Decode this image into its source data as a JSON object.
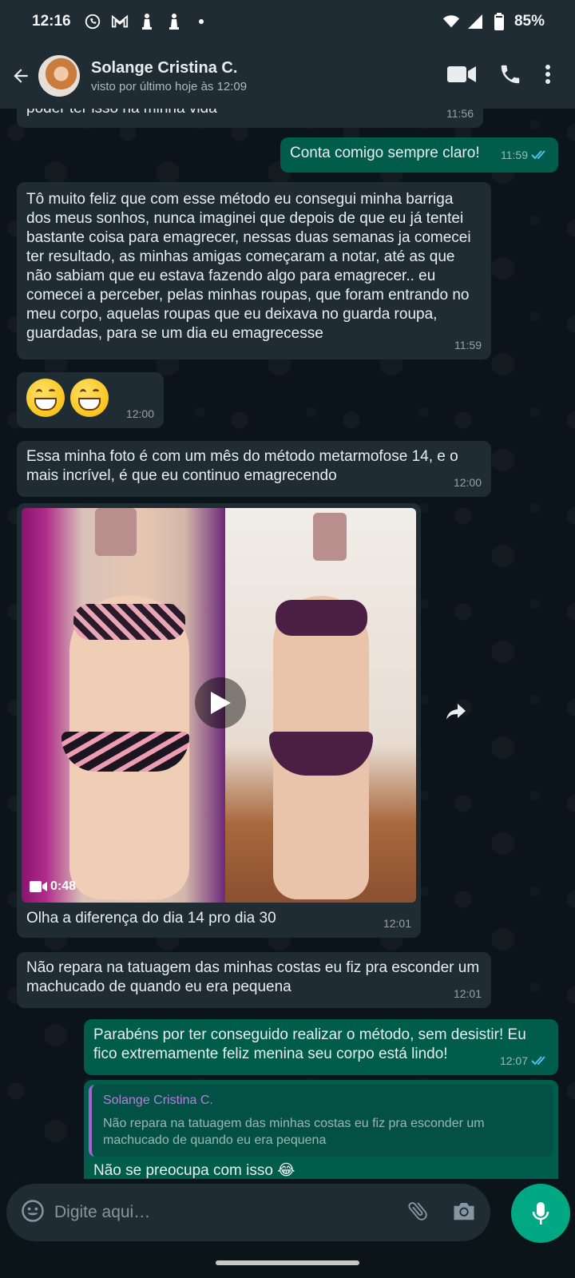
{
  "status_bar": {
    "time": "12:16",
    "battery": "85%",
    "icons": [
      "whatsapp-icon",
      "gmail-icon",
      "chess-icon",
      "chess-icon",
      "dot-icon",
      "wifi-icon",
      "signal-icon",
      "battery-icon"
    ]
  },
  "header": {
    "contact_name": "Solange Cristina C.",
    "last_seen": "visto por último hoje às 12:09",
    "icons": [
      "back-arrow-icon",
      "video-call-icon",
      "phone-icon",
      "more-vert-icon"
    ]
  },
  "messages": [
    {
      "id": "m0",
      "direction": "in",
      "text": "poder ter isso na minha vida",
      "time": "11:56"
    },
    {
      "id": "m1",
      "direction": "out",
      "text": "Conta comigo sempre claro!",
      "time": "11:59",
      "read": true
    },
    {
      "id": "m2",
      "direction": "in",
      "text": "Tô muito feliz que com esse método eu consegui minha barriga dos meus sonhos, nunca imaginei que depois de que eu já tentei bastante coisa para emagrecer, nessas duas semanas ja comecei ter resultado, as minhas amigas começaram a notar, até as que não sabiam que eu estava fazendo algo para emagrecer.. eu comecei a perceber, pelas minhas roupas, que foram entrando no meu corpo, aquelas roupas que eu deixava no guarda roupa, guardadas, para se um dia eu emagrecesse",
      "time": "11:59"
    },
    {
      "id": "m3",
      "direction": "in",
      "text": "😁😁",
      "time": "12:00"
    },
    {
      "id": "m4",
      "direction": "in",
      "text": "Essa minha foto é com um mês do método metarmofose 14, e o mais incrível, é que eu continuo emagrecendo",
      "time": "12:00"
    },
    {
      "id": "m5",
      "direction": "in",
      "type": "video",
      "duration": "0:48",
      "caption": "Olha a diferença do dia 14 pro dia 30",
      "time": "12:01"
    },
    {
      "id": "m6",
      "direction": "in",
      "text": "Não repara na tatuagem das minhas costas eu fiz pra esconder um machucado de quando eu era pequena",
      "time": "12:01"
    },
    {
      "id": "m7",
      "direction": "out",
      "text": "Parabéns por ter conseguido realizar o método, sem desistir! Eu fico extremamente feliz menina seu corpo está lindo!",
      "time": "12:07",
      "read": true
    },
    {
      "id": "m8",
      "direction": "out",
      "quote_author": "Solange Cristina C.",
      "quote_text": "Não repara na tatuagem das minhas costas eu fiz pra esconder um machucado de quando eu era pequena",
      "text": "Não se preocupa com isso 😂"
    }
  ],
  "input": {
    "placeholder": "Digite aqui…",
    "icons": [
      "emoji-icon",
      "attach-icon",
      "camera-icon",
      "mic-icon"
    ]
  },
  "colors": {
    "incoming_bubble": "#1f2c33",
    "outgoing_bubble": "#005c4b",
    "accent": "#00a884",
    "read_tick": "#53bdeb",
    "quote_author": "#b57fde"
  }
}
